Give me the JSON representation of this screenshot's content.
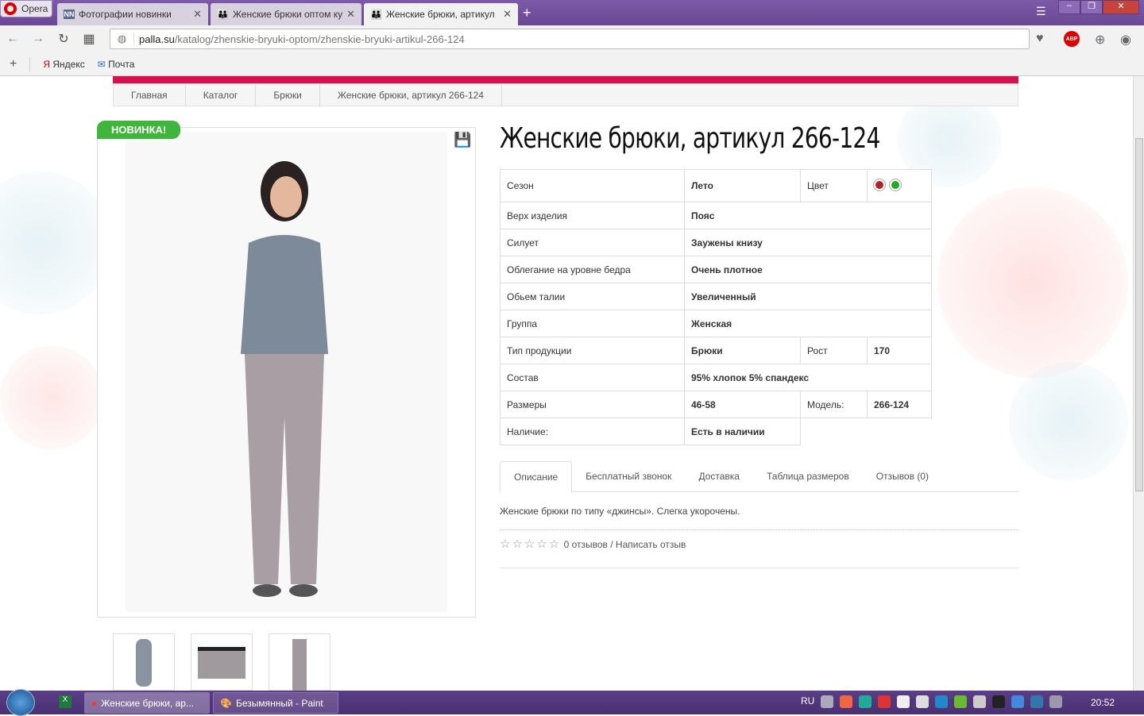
{
  "browser": {
    "menu_label": "Opera",
    "tabs": [
      {
        "title": "Фотографии новинки"
      },
      {
        "title": "Женские брюки оптом ку"
      },
      {
        "title": "Женские брюки, артикул"
      }
    ],
    "url_domain": "palla.su",
    "url_path": "/katalog/zhenskie-bryuki-optom/zhenskie-bryuki-artikul-266-124",
    "bookmarks": [
      {
        "label": "Яндекс"
      },
      {
        "label": "Почта"
      }
    ]
  },
  "breadcrumb": [
    "Главная",
    "Каталог",
    "Брюки",
    "Женские брюки, артикул 266-124"
  ],
  "product": {
    "badge": "НОВИНКА!",
    "title": "Женские брюки, артикул 266-124",
    "colors": [
      "#b22222",
      "#22aa22"
    ],
    "specs": {
      "season_label": "Сезон",
      "season": "Лето",
      "color_label": "Цвет",
      "top_label": "Верх изделия",
      "top": "Пояс",
      "silhouette_label": "Силует",
      "silhouette": "Заужены книзу",
      "hip_label": "Облегание на уровне бедра",
      "hip": "Очень плотное",
      "waist_label": "Обьем талии",
      "waist": "Увеличенный",
      "group_label": "Группа",
      "group": "Женская",
      "type_label": "Тип продукции",
      "type": "Брюки",
      "height_label": "Рост",
      "height": "170",
      "composition_label": "Состав",
      "composition": "95% хлопок 5% спандекс",
      "sizes_label": "Размеры",
      "sizes": "46-58",
      "model_label": "Модель:",
      "model": "266-124",
      "availability_label": "Наличие:",
      "availability": "Есть в наличии"
    }
  },
  "tabs": [
    "Описание",
    "Бесплатный звонок",
    "Доставка",
    "Таблица размеров",
    "Отзывов (0)"
  ],
  "description": "Женские брюки по типу «джинсы». Слегка укорочены.",
  "rating": {
    "stars": 0,
    "text": "0 отзывов / Написать отзыв"
  },
  "taskbar": {
    "items": [
      "Женские брюки, ар...",
      "Безымянный - Paint"
    ],
    "lang": "RU",
    "time": "20:52"
  }
}
